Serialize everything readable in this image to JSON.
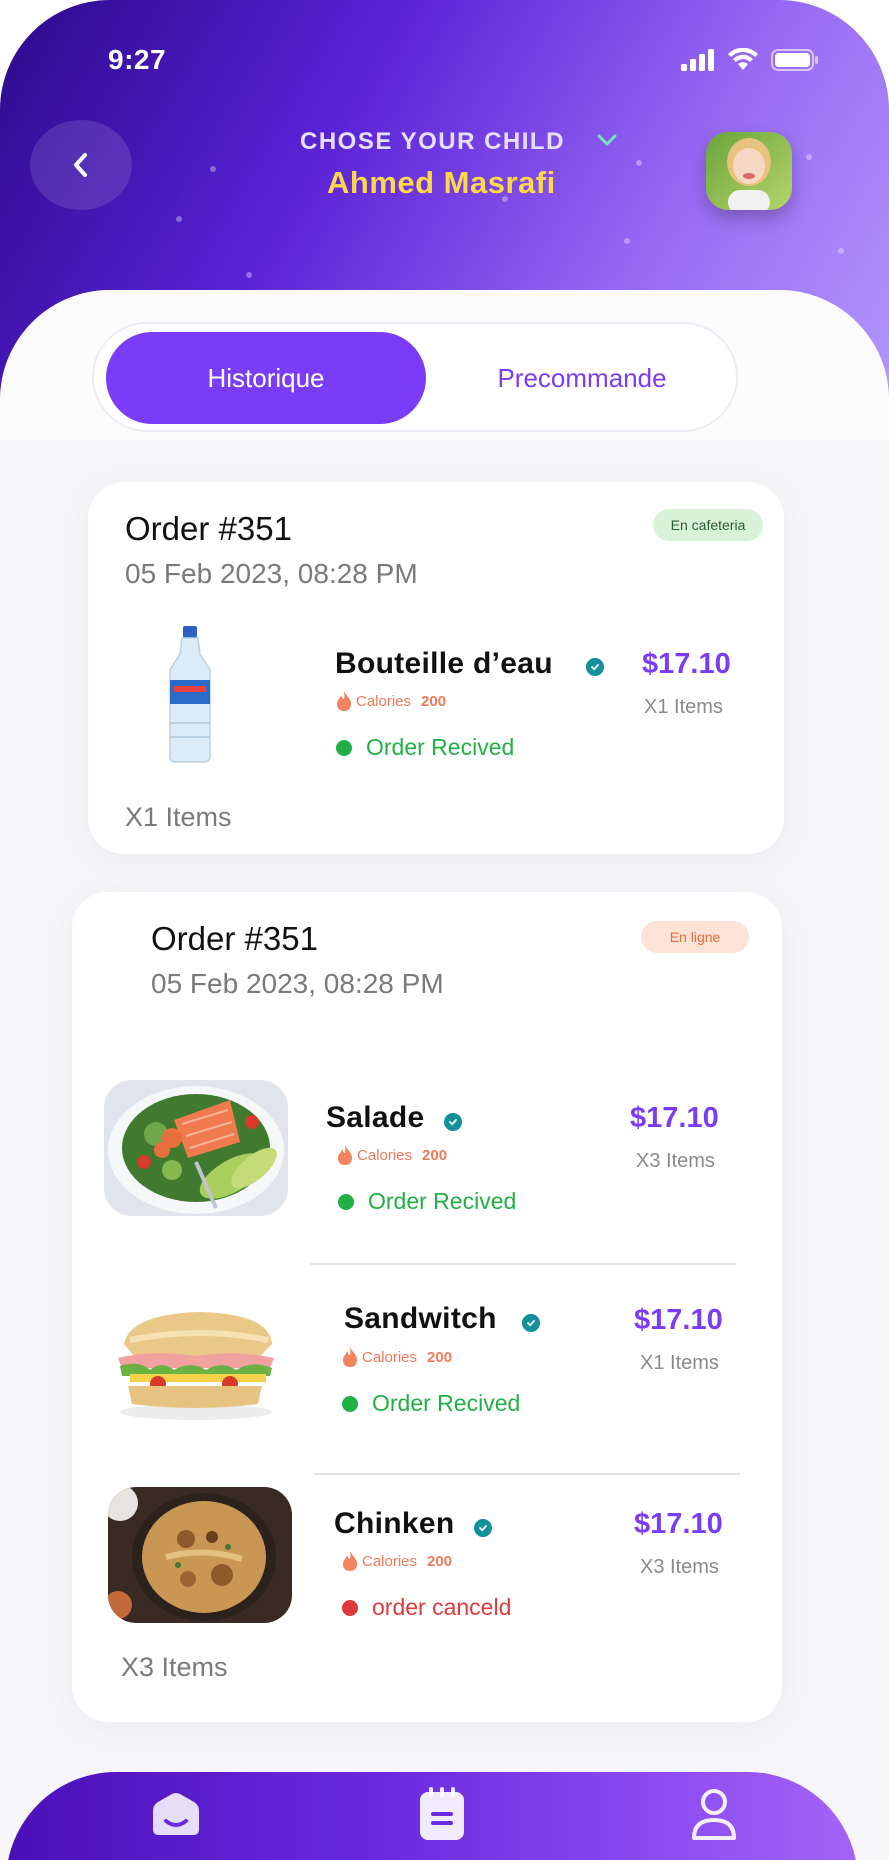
{
  "status_bar": {
    "time": "9:27"
  },
  "header": {
    "child_label": "CHOSE YOUR CHILD",
    "child_name": "Ahmed Masrafi"
  },
  "tabs": [
    {
      "label": "Historique",
      "active": true
    },
    {
      "label": "Precommande",
      "active": false
    }
  ],
  "orders": [
    {
      "title": "Order #351",
      "date": "05 Feb 2023, 08:28 PM",
      "badge": "En cafeteria",
      "items_total": "X1 Items",
      "items": [
        {
          "name": "Bouteille d’eau",
          "calories_label": "Calories",
          "calories_value": "200",
          "status": "Order Recived",
          "price": "$17.10",
          "qty": "X1 Items",
          "image": "water-bottle"
        }
      ]
    },
    {
      "title": "Order #351",
      "date": "05 Feb 2023, 08:28 PM",
      "badge": "En ligne",
      "items_total": "X3 Items",
      "items": [
        {
          "name": "Salade",
          "calories_label": "Calories",
          "calories_value": "200",
          "status": "Order Recived",
          "price": "$17.10",
          "qty": "X3 Items",
          "image": "salmon-salad"
        },
        {
          "name": "Sandwitch",
          "calories_label": "Calories",
          "calories_value": "200",
          "status": "Order Recived",
          "price": "$17.10",
          "qty": "X1 Items",
          "image": "sandwich"
        },
        {
          "name": "Chinken",
          "calories_label": "Calories",
          "calories_value": "200",
          "status": "order canceld",
          "price": "$17.10",
          "qty": "X3 Items",
          "image": "chicken-rice"
        }
      ]
    }
  ],
  "colors": {
    "accent": "#7a3cf7",
    "child_name": "#ffd84a",
    "status_received": "#22b045",
    "status_cancelled": "#e03b3b",
    "badge_cafeteria_bg": "#d8f1d9",
    "badge_online_bg": "#fde2d6"
  },
  "icons": {
    "back": "chevron-left-icon",
    "dropdown": "chevron-down-icon",
    "verified": "verified-check-icon",
    "calories": "flame-icon",
    "nav": [
      "home-icon",
      "notepad-icon",
      "user-icon"
    ]
  }
}
